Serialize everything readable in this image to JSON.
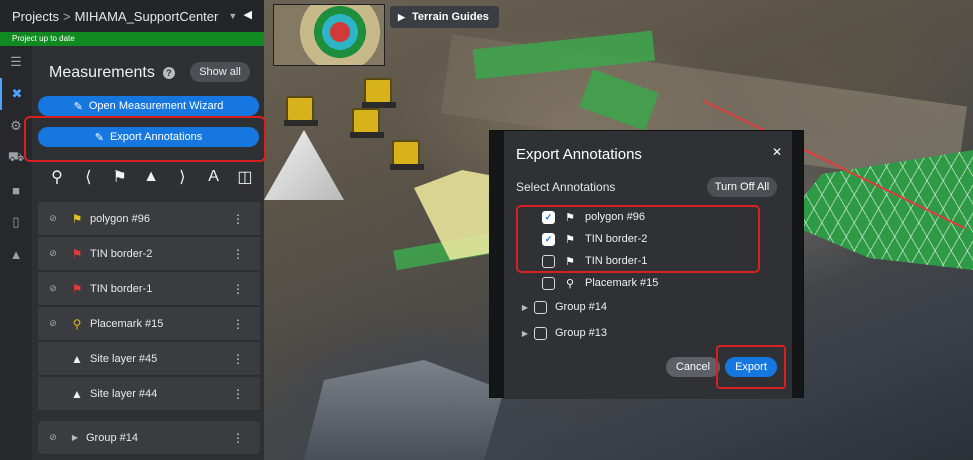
{
  "header": {
    "breadcrumb_root": "Projects",
    "separator": ">",
    "project_name": "MIHAMA_SupportCenter",
    "caret_icon": "chevron-down-icon",
    "collapse_icon": "collapse-left-icon"
  },
  "status": {
    "text": "Project up to date",
    "color": "#118a21"
  },
  "rail": {
    "icons": [
      "layers-icon",
      "measure-icon",
      "settings-gear-icon",
      "vehicles-icon",
      "folder-icon",
      "device-icon",
      "objects-icon"
    ],
    "active_index": 1
  },
  "panel": {
    "title": "Measurements",
    "help_glyph": "?",
    "show_all_label": "Show all",
    "wizard_label": "Open Measurement Wizard",
    "export_label": "Export Annotations",
    "toolbar_icons": [
      "placemark-icon",
      "angle-icon",
      "polygon-icon",
      "mountain-icon",
      "chevron-icon",
      "text-icon",
      "folder-open-icon"
    ],
    "items": [
      {
        "label": "polygon #96",
        "icon": "polygon-flag-icon",
        "icon_color": "#e0c020",
        "has_eye": true
      },
      {
        "label": "TIN border-2",
        "icon": "polygon-flag-icon",
        "icon_color": "#e23b3b",
        "has_eye": true
      },
      {
        "label": "TIN border-1",
        "icon": "polygon-flag-icon",
        "icon_color": "#e23b3b",
        "has_eye": true
      },
      {
        "label": "Placemark #15",
        "icon": "placemark-icon",
        "icon_color": "#e8b020",
        "has_eye": true
      },
      {
        "label": "Site layer #45",
        "icon": "mountain-icon",
        "icon_color": "#eeeeee",
        "has_eye": false
      },
      {
        "label": "Site layer #44",
        "icon": "mountain-icon",
        "icon_color": "#eeeeee",
        "has_eye": false
      }
    ],
    "group": {
      "label": "Group #14"
    }
  },
  "viewport": {
    "terrain_guides_label": "Terrain Guides"
  },
  "modal": {
    "title": "Export Annotations",
    "subtitle": "Select Annotations",
    "turn_off_all_label": "Turn Off All",
    "cancel_label": "Cancel",
    "export_label": "Export",
    "rows": [
      {
        "label": "polygon #96",
        "checked": true,
        "icon": "polygon-flag-icon",
        "group": false
      },
      {
        "label": "TIN border-2",
        "checked": true,
        "icon": "polygon-flag-icon",
        "group": false
      },
      {
        "label": "TIN border-1",
        "checked": false,
        "icon": "polygon-flag-icon",
        "group": false
      },
      {
        "label": "Placemark #15",
        "checked": false,
        "icon": "placemark-icon",
        "group": false
      },
      {
        "label": "Group #14",
        "checked": false,
        "icon": "",
        "group": true
      },
      {
        "label": "Group #13",
        "checked": false,
        "icon": "",
        "group": true
      }
    ]
  },
  "colors": {
    "accent": "#1677e0",
    "highlight": "#d82020",
    "panel_bg": "#2e3033"
  }
}
